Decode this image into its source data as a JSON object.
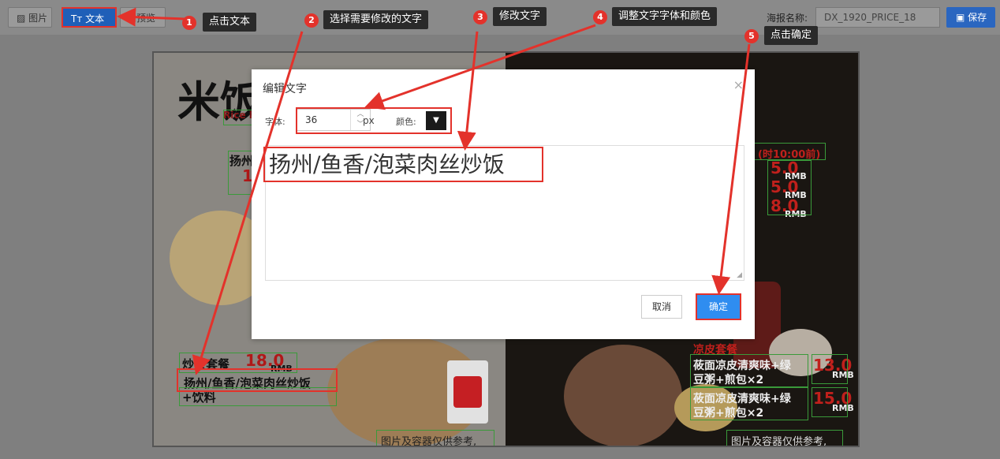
{
  "toolbar": {
    "image_label": "图片",
    "text_label": "Tт 文本",
    "preview_label": "预览",
    "poster_name_label": "海报名称:",
    "poster_name_value": "DX_1920_PRICE_18",
    "save_label": "保存"
  },
  "steps": [
    {
      "num": "1",
      "text": "点击文本"
    },
    {
      "num": "2",
      "text": "选择需要修改的文字"
    },
    {
      "num": "3",
      "text": "修改文字"
    },
    {
      "num": "4",
      "text": "调整文字字体和颜色"
    },
    {
      "num": "5",
      "text": "点击确定"
    }
  ],
  "poster": {
    "brand": "米饭",
    "brand_sub": "Rice l",
    "left_item_title_partial": "扬州",
    "left_item_price_partial": "1",
    "combo_title": "炒饭套餐",
    "combo_price": "18.0",
    "combo_rmb": "RMB",
    "combo_item": "扬州/鱼香/泡菜肉丝炒饭",
    "combo_item2": "+饮料",
    "footnote": "图片及容器仅供参考,",
    "right_top_time": "(时10:00前)",
    "right_prices": [
      {
        "price": "5.0",
        "unit": "RMB"
      },
      {
        "price": "5.0",
        "unit": "RMB"
      },
      {
        "price": "8.0",
        "unit": "RMB"
      }
    ],
    "right_combo_title": "凉皮套餐",
    "right_items": [
      {
        "line1": "莜面凉皮清爽味+绿",
        "line2": "豆粥+煎包×2",
        "price": "13.0",
        "unit": "RMB"
      },
      {
        "line1": "莜面凉皮清爽味+绿",
        "line2": "豆粥+煎包×2",
        "price": "15.0",
        "unit": "RMB"
      }
    ],
    "right_footnote": "图片及容器仅供参考,"
  },
  "modal": {
    "title": "编辑文字",
    "close": "×",
    "font_label": "字体:",
    "font_size": "36",
    "unit": "px",
    "color_label": "颜色:",
    "color_value": "#1a1a1a",
    "text_value": "扬州/鱼香/泡菜肉丝炒饭",
    "cancel_label": "取消",
    "ok_label": "确定"
  }
}
